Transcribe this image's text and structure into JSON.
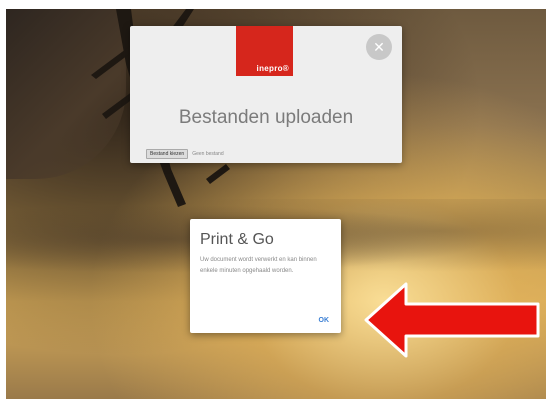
{
  "background": {
    "description_icon": "desert-sunset-background"
  },
  "upload_dialog": {
    "logo_text": "inepro®",
    "logo_color": "#d6261c",
    "close_icon": "close-icon",
    "title": "Bestanden uploaden",
    "file_button_label": "Bestand kiezen",
    "file_status": "Geen bestand"
  },
  "print_go_dialog": {
    "title": "Print & Go",
    "message": "Uw document wordt verwerkt en kan binnen enkele minuten opgehaald worden.",
    "ok_label": "OK"
  },
  "annotation": {
    "arrow_icon": "red-arrow-left",
    "arrow_color": "#e8140e"
  }
}
